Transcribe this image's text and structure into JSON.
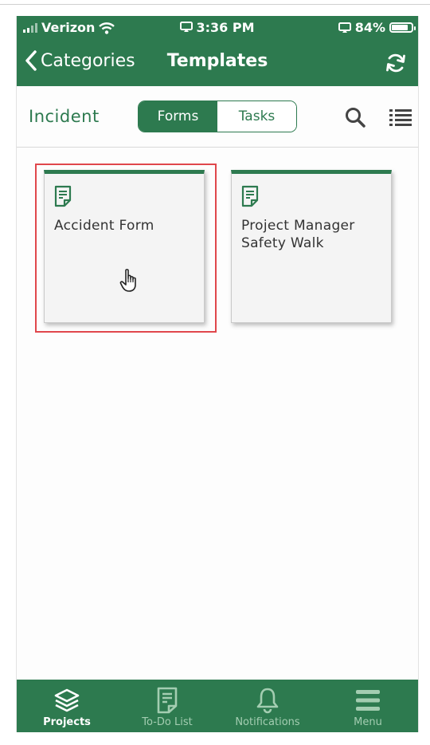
{
  "status_bar": {
    "carrier": "Verizon",
    "time": "3:36 PM",
    "battery": "84%",
    "battery_level": 0.84
  },
  "nav": {
    "back_label": "Categories",
    "title": "Templates",
    "refresh_icon": "refresh-icon"
  },
  "subheader": {
    "category": "Incident",
    "segments": [
      {
        "label": "Forms",
        "selected": true
      },
      {
        "label": "Tasks",
        "selected": false
      }
    ],
    "search_icon": "search-icon",
    "list_icon": "list-view-icon"
  },
  "templates": [
    {
      "name": "Accident Form",
      "icon": "form-document-icon"
    },
    {
      "name": "Project Manager Safety Walk",
      "icon": "form-document-icon"
    }
  ],
  "tab_bar": [
    {
      "label": "Projects",
      "icon": "layers-icon",
      "active": true
    },
    {
      "label": "To-Do List",
      "icon": "todo-document-icon",
      "active": false
    },
    {
      "label": "Notifications",
      "icon": "bell-icon",
      "active": false
    },
    {
      "label": "Menu",
      "icon": "hamburger-menu-icon",
      "active": false
    }
  ],
  "colors": {
    "brand_green": "#2d7a4f",
    "highlight_red": "#e0474c",
    "inactive_tab_label": "#a3cdb1"
  }
}
